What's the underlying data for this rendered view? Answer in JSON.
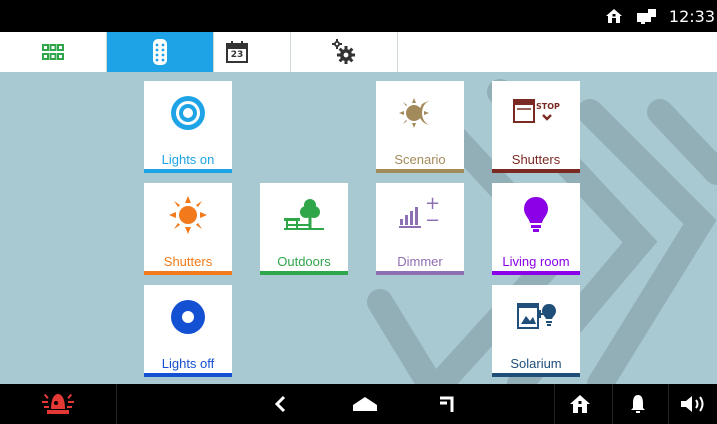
{
  "status": {
    "time": "12:33",
    "icons": [
      "home-icon",
      "notification-icon"
    ]
  },
  "tabs": [
    {
      "id": "apps",
      "icon": "grid-icon",
      "active": false
    },
    {
      "id": "remote",
      "icon": "remote-control-icon",
      "active": true
    },
    {
      "id": "calendar",
      "icon": "calendar-icon",
      "label": "23",
      "active": false
    },
    {
      "id": "settings",
      "icon": "gears-icon",
      "active": false
    }
  ],
  "tiles": [
    {
      "name": "lights-on",
      "label": "Lights on",
      "icon": "lights-on-icon",
      "color": "#1ea4e6"
    },
    {
      "name": "scenario",
      "label": "Scenario",
      "icon": "day-night-icon",
      "color": "#a38a5b"
    },
    {
      "name": "shutters-stop",
      "label": "Shutters",
      "icon": "shutter-stop-icon",
      "color": "#7a2a22",
      "icon_text": "STOP"
    },
    {
      "name": "shutters-sun",
      "label": "Shutters",
      "icon": "sun-icon",
      "color": "#f27a1a"
    },
    {
      "name": "outdoors",
      "label": "Outdoors",
      "icon": "tree-bench-icon",
      "color": "#2fa64a"
    },
    {
      "name": "dimmer",
      "label": "Dimmer",
      "icon": "dimmer-icon",
      "color": "#8f6fb3",
      "icon_text_plus": "+",
      "icon_text_minus": "−"
    },
    {
      "name": "living-room",
      "label": "Living room",
      "icon": "bulb-icon",
      "color": "#8b00e6"
    },
    {
      "name": "lights-off",
      "label": "Lights off",
      "icon": "lights-off-icon",
      "color": "#1450d2"
    },
    {
      "name": "solarium",
      "label": "Solarium",
      "icon": "solarium-icon",
      "color": "#1f4e79"
    }
  ],
  "bottombar": {
    "alarm_color": "#e53935",
    "items": [
      "alarm-icon",
      "back-icon",
      "home-icon",
      "recent-icon",
      "house-icon",
      "bell-icon",
      "volume-icon"
    ]
  }
}
